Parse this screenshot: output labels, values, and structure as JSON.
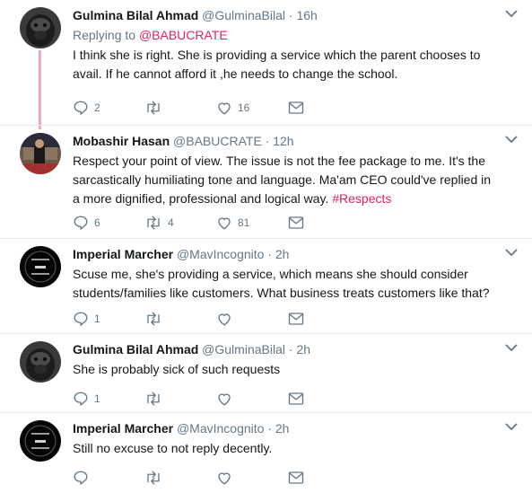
{
  "tweets": [
    {
      "name": "Gulmina Bilal Ahmad",
      "handle": "@GulminaBilal",
      "time": "16h",
      "replying_prefix": "Replying to ",
      "replying_to": "@BABUCRATE",
      "text": "I think she is right.  She is providing a service which the parent chooses to avail. If he cannot afford it ,he needs to  change the school.",
      "reply_count": "2",
      "retweet_count": "",
      "like_count": "16",
      "avatar": "gorilla-avatar"
    },
    {
      "name": "Mobashir Hasan",
      "handle": "@BABUCRATE",
      "time": "12h",
      "text": "Respect your point of view. The issue is not the fee package to me.  It's the sarcastically humiliating tone and language. Ma'am CEO could've replied in a more dignified, professional and logical way. ",
      "hashtag": "#Respects",
      "reply_count": "6",
      "retweet_count": "4",
      "like_count": "81",
      "avatar": "photo-avatar"
    },
    {
      "name": "Imperial Marcher",
      "handle": "@MavIncognito",
      "time": "2h",
      "text": "Scuse me, she's providing a service, which means she should consider students/families like customers. What business treats customers like that?",
      "reply_count": "1",
      "retweet_count": "",
      "like_count": "",
      "avatar": "dark-logo-avatar"
    },
    {
      "name": "Gulmina Bilal Ahmad",
      "handle": "@GulminaBilal",
      "time": "2h",
      "text": "She is probably sick of such requests",
      "reply_count": "1",
      "retweet_count": "",
      "like_count": "",
      "avatar": "gorilla-avatar"
    },
    {
      "name": "Imperial Marcher",
      "handle": "@MavIncognito",
      "time": "2h",
      "text": "Still no excuse to not reply decently.",
      "reply_count": "",
      "retweet_count": "",
      "like_count": "",
      "avatar": "dark-logo-avatar"
    }
  ],
  "separator": "·",
  "colors": {
    "accent": "#e0245e",
    "muted": "#657786",
    "thread": "#f5a9b8"
  },
  "icons": [
    "reply-icon",
    "retweet-icon",
    "like-icon",
    "dm-icon",
    "chevron-down-icon"
  ]
}
